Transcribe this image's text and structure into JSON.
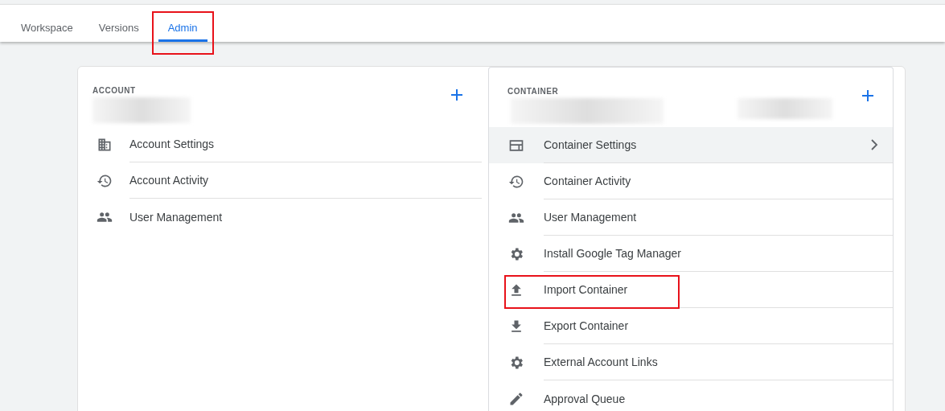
{
  "tabs": [
    {
      "label": "Workspace",
      "selected": false,
      "highlighted": false
    },
    {
      "label": "Versions",
      "selected": false,
      "highlighted": false
    },
    {
      "label": "Admin",
      "selected": true,
      "highlighted": true
    }
  ],
  "account": {
    "heading": "ACCOUNT",
    "items": [
      {
        "kind": "building",
        "label": "Account Settings",
        "selected": false,
        "highlighted": false,
        "chevron": false
      },
      {
        "kind": "history",
        "label": "Account Activity",
        "selected": false,
        "highlighted": false,
        "chevron": false
      },
      {
        "kind": "people",
        "label": "User Management",
        "selected": false,
        "highlighted": false,
        "chevron": false
      }
    ]
  },
  "container": {
    "heading": "CONTAINER",
    "items": [
      {
        "kind": "window",
        "label": "Container Settings",
        "selected": true,
        "highlighted": false,
        "chevron": true
      },
      {
        "kind": "history",
        "label": "Container Activity",
        "selected": false,
        "highlighted": false,
        "chevron": false
      },
      {
        "kind": "people",
        "label": "User Management",
        "selected": false,
        "highlighted": false,
        "chevron": false
      },
      {
        "kind": "gear",
        "label": "Install Google Tag Manager",
        "selected": false,
        "highlighted": false,
        "chevron": false
      },
      {
        "kind": "upload",
        "label": "Import Container",
        "selected": false,
        "highlighted": true,
        "chevron": false
      },
      {
        "kind": "download",
        "label": "Export Container",
        "selected": false,
        "highlighted": false,
        "chevron": false
      },
      {
        "kind": "gear",
        "label": "External Account Links",
        "selected": false,
        "highlighted": false,
        "chevron": false
      },
      {
        "kind": "pencil",
        "label": "Approval Queue",
        "selected": false,
        "highlighted": false,
        "chevron": false
      }
    ]
  }
}
